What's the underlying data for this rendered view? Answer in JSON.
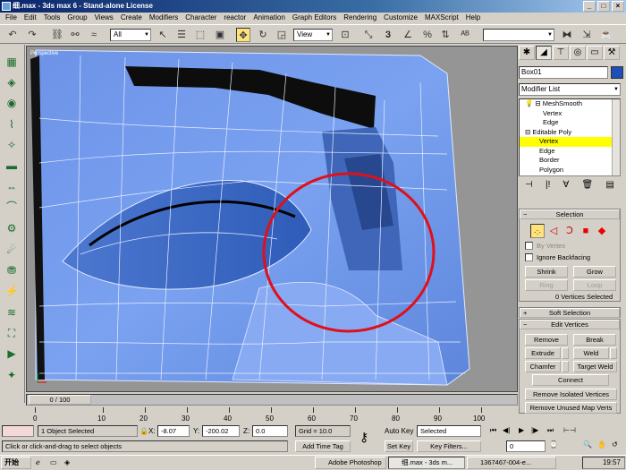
{
  "window": {
    "title": "细.max - 3ds max 6 - Stand-alone License",
    "btn_min": "_",
    "btn_max": "□",
    "btn_close": "×"
  },
  "menu": [
    "File",
    "Edit",
    "Tools",
    "Group",
    "Views",
    "Create",
    "Modifiers",
    "Character",
    "reactor",
    "Animation",
    "Graph Editors",
    "Rendering",
    "Customize",
    "MAXScript",
    "Help"
  ],
  "toolbar": {
    "selection_filter": "All",
    "ref_coord": "View",
    "named_selection": ""
  },
  "viewport": {
    "label": "Perspective"
  },
  "panel": {
    "object_name": "Box01",
    "object_color": "#1d4fb8",
    "modifier_list": "Modifier List",
    "stack": [
      {
        "label": "MeshSmooth",
        "indent": 1
      },
      {
        "label": "Vertex",
        "indent": 3
      },
      {
        "label": "Edge",
        "indent": 3
      },
      {
        "label": "Editable Poly",
        "indent": 1
      },
      {
        "label": "Vertex",
        "indent": 3,
        "selected": true
      },
      {
        "label": "Edge",
        "indent": 3
      },
      {
        "label": "Border",
        "indent": 3
      },
      {
        "label": "Polygon",
        "indent": 3
      }
    ],
    "selection": {
      "title": "Selection",
      "by_vertex": "By Vertex",
      "ignore_backfacing": "Ignore Backfacing",
      "shrink": "Shrink",
      "grow": "Grow",
      "ring": "Ring",
      "loop": "Loop",
      "status": "0 Vertices Selected"
    },
    "soft_selection": "Soft Selection",
    "edit_vertices": {
      "title": "Edit Vertices",
      "remove": "Remove",
      "break": "Break",
      "extrude": "Extrude",
      "weld": "Weld",
      "chamfer": "Chamfer",
      "target_weld": "Target Weld",
      "connect": "Connect",
      "remove_isolated": "Remove Isolated Vertices",
      "remove_unused": "Remove Unused Map Verts"
    }
  },
  "timeline": {
    "slider": "0 / 100",
    "ticks": [
      "0",
      "10",
      "20",
      "30",
      "40",
      "50",
      "60",
      "70",
      "80",
      "90",
      "100"
    ]
  },
  "status": {
    "selected": "1 Object Selected",
    "prompt": "Click or click-and-drag to select objects",
    "x_label": "X:",
    "x": "-8.07",
    "y_label": "Y:",
    "y": "-200.02",
    "z_label": "Z:",
    "z": "0.0",
    "grid": "Grid = 10.0",
    "add_time_tag": "Add Time Tag",
    "auto_key": "Auto Key",
    "auto_key_value": "Selected",
    "set_key": "Set Key",
    "key_filters": "Key Filters...",
    "frame": "0"
  },
  "taskbar": {
    "start": "开始",
    "tasks": [
      "Adobe Photoshop",
      "细.max - 3ds m...",
      "1367467-004-e..."
    ],
    "clock": "19:57"
  }
}
